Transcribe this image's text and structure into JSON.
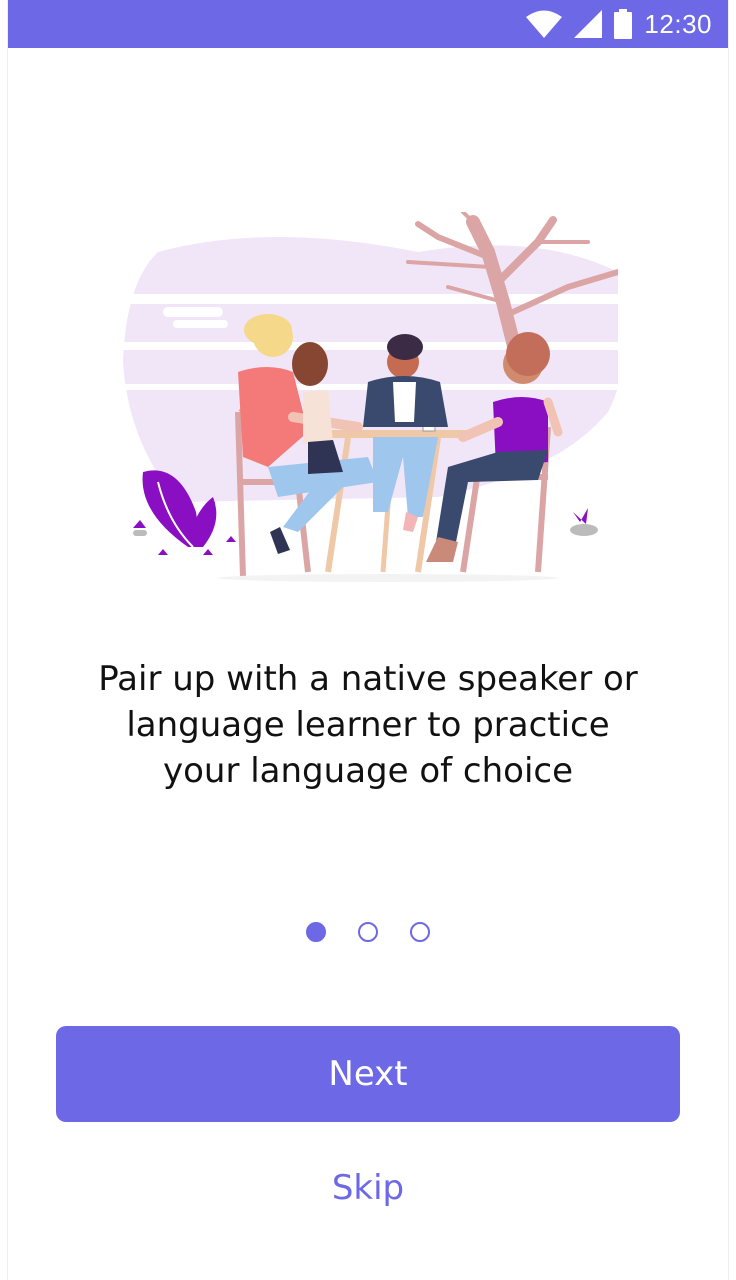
{
  "status_bar": {
    "time": "12:30",
    "icons": [
      "wifi-icon",
      "cellular-signal-icon",
      "battery-icon"
    ],
    "color": "#6c68e6"
  },
  "illustration": {
    "description_icon": "people-at-cafe-table-illustration"
  },
  "onboarding": {
    "text_line_1": "Pair up with a native speaker or",
    "text_line_2": "language learner to practice",
    "text_line_3": "your language of choice"
  },
  "pager": {
    "total": 3,
    "active_index": 0
  },
  "actions": {
    "next_label": "Next",
    "skip_label": "Skip"
  },
  "colors": {
    "accent": "#6c68e6",
    "text": "#111111",
    "illustration_bg": "#f1e6f8",
    "plant": "#8a0fc2"
  }
}
